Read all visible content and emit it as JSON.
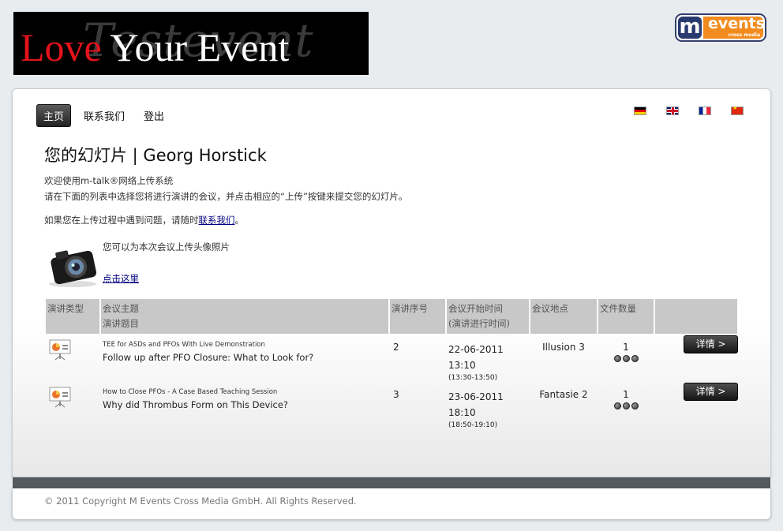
{
  "banner": {
    "love": "Love",
    "rest": "Your Event",
    "ghost": "Testevent"
  },
  "logo": {
    "letter": "m",
    "word": "events",
    "sub": "cross media"
  },
  "nav": {
    "home": "主页",
    "contact": "联系我们",
    "logout": "登出"
  },
  "languages": [
    "de",
    "en",
    "fr",
    "zh"
  ],
  "page": {
    "title": "您的幻灯片 | Georg Horstick",
    "welcome": "欢迎使用m-talk®网络上传系统",
    "instructions": "请在下面的列表中选择您将进行演讲的会议，并点击相应的“上传”按键来提交您的幻灯片。",
    "problem_prefix": "如果您在上传过程中遇到问题，请随时",
    "problem_link": "联系我们",
    "problem_suffix": "。",
    "photo_text": "您可以为本次会议上传头像照片",
    "photo_link": "点击这里"
  },
  "table": {
    "headers": {
      "type": "演讲类型",
      "topic": "会议主题",
      "talk_title": "演讲题目",
      "seq": "演讲序号",
      "start": "会议开始时间",
      "time": "(演讲进行时间)",
      "location": "会议地点",
      "files": "文件数量"
    },
    "rows": [
      {
        "session": "TEE for ASDs and PFOs With Live Demonstration",
        "title": "Follow up after PFO Closure: What to Look for?",
        "seq": "2",
        "date": "22-06-2011",
        "time": "13:10",
        "slot": "(13:30-13:50)",
        "location": "Illusion 3",
        "files": "1",
        "button": "详情 >"
      },
      {
        "session": "How to Close PFOs - A Case Based Teaching Session",
        "title": "Why did Thrombus Form on This Device?",
        "seq": "3",
        "date": "23-06-2011",
        "time": "18:10",
        "slot": "(18:50-19:10)",
        "location": "Fantasie 2",
        "files": "1",
        "button": "详情 >"
      }
    ]
  },
  "footer": {
    "copyright": "© 2011 Copyright M Events Cross Media GmbH. All Rights Reserved."
  }
}
